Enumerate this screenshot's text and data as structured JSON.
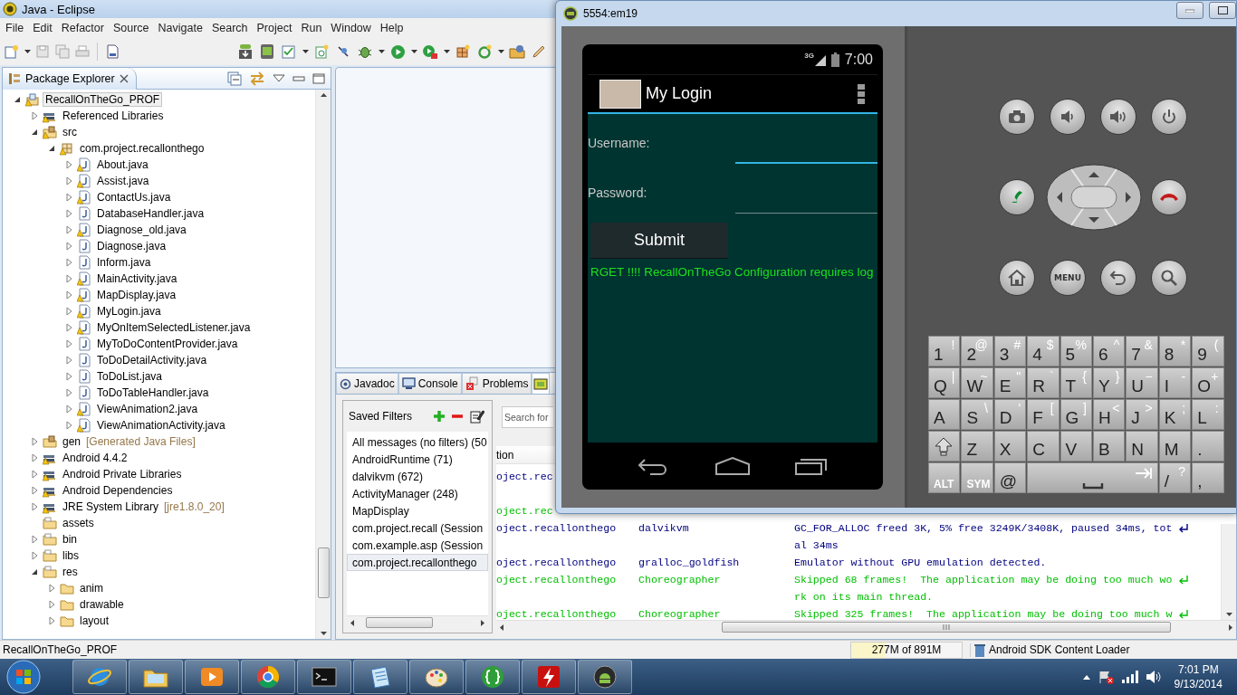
{
  "eclipse": {
    "title": "Java - Eclipse",
    "menu": [
      "File",
      "Edit",
      "Refactor",
      "Source",
      "Navigate",
      "Search",
      "Project",
      "Run",
      "Window",
      "Help"
    ],
    "package_explorer": {
      "title": "Package Explorer",
      "tree": [
        {
          "label": "RecallOnTheGo_PROF",
          "kind": "project",
          "expanded": true,
          "selected": true,
          "warning": true,
          "children": [
            {
              "label": "Referenced Libraries",
              "kind": "library",
              "expanded": false,
              "selected": false,
              "warning": true
            },
            {
              "label": "src",
              "kind": "source-folder",
              "expanded": true,
              "selected": false,
              "warning": true,
              "children": [
                {
                  "label": "com.project.recallonthego",
                  "kind": "package",
                  "expanded": true,
                  "selected": false,
                  "warning": true,
                  "children": [
                    {
                      "label": "About.java",
                      "kind": "java",
                      "expanded": false,
                      "selected": false,
                      "warning": true
                    },
                    {
                      "label": "Assist.java",
                      "kind": "java",
                      "expanded": false,
                      "selected": false,
                      "warning": true
                    },
                    {
                      "label": "ContactUs.java",
                      "kind": "java",
                      "expanded": false,
                      "selected": false,
                      "warning": true
                    },
                    {
                      "label": "DatabaseHandler.java",
                      "kind": "java",
                      "expanded": false,
                      "selected": false,
                      "warning": false
                    },
                    {
                      "label": "Diagnose_old.java",
                      "kind": "java",
                      "expanded": false,
                      "selected": false,
                      "warning": true
                    },
                    {
                      "label": "Diagnose.java",
                      "kind": "java",
                      "expanded": false,
                      "selected": false,
                      "warning": false
                    },
                    {
                      "label": "Inform.java",
                      "kind": "java",
                      "expanded": false,
                      "selected": false,
                      "warning": false
                    },
                    {
                      "label": "MainActivity.java",
                      "kind": "java",
                      "expanded": false,
                      "selected": false,
                      "warning": true
                    },
                    {
                      "label": "MapDisplay.java",
                      "kind": "java",
                      "expanded": false,
                      "selected": false,
                      "warning": true
                    },
                    {
                      "label": "MyLogin.java",
                      "kind": "java",
                      "expanded": false,
                      "selected": false,
                      "warning": true
                    },
                    {
                      "label": "MyOnItemSelectedListener.java",
                      "kind": "java",
                      "expanded": false,
                      "selected": false,
                      "warning": true
                    },
                    {
                      "label": "MyToDoContentProvider.java",
                      "kind": "java",
                      "expanded": false,
                      "selected": false,
                      "warning": false
                    },
                    {
                      "label": "ToDoDetailActivity.java",
                      "kind": "java",
                      "expanded": false,
                      "selected": false,
                      "warning": false
                    },
                    {
                      "label": "ToDoList.java",
                      "kind": "java",
                      "expanded": false,
                      "selected": false,
                      "warning": false
                    },
                    {
                      "label": "ToDoTableHandler.java",
                      "kind": "java",
                      "expanded": false,
                      "selected": false,
                      "warning": false
                    },
                    {
                      "label": "ViewAnimation2.java",
                      "kind": "java",
                      "expanded": false,
                      "selected": false,
                      "warning": true
                    },
                    {
                      "label": "ViewAnimationActivity.java",
                      "kind": "java",
                      "expanded": false,
                      "selected": false,
                      "warning": true
                    }
                  ]
                }
              ]
            },
            {
              "label": "gen",
              "decoration": "[Generated Java Files]",
              "kind": "source-folder",
              "expanded": false,
              "selected": false,
              "warning": false
            },
            {
              "label": "Android 4.4.2",
              "kind": "library",
              "expanded": false,
              "selected": false,
              "warning": true
            },
            {
              "label": "Android Private Libraries",
              "kind": "library",
              "expanded": false,
              "selected": false,
              "warning": true
            },
            {
              "label": "Android Dependencies",
              "kind": "library",
              "expanded": false,
              "selected": false,
              "warning": true
            },
            {
              "label": "JRE System Library",
              "decoration": "[jre1.8.0_20]",
              "kind": "library",
              "expanded": false,
              "selected": false,
              "warning": true
            },
            {
              "label": "assets",
              "kind": "folder-res",
              "selected": false,
              "warning": false
            },
            {
              "label": "bin",
              "kind": "folder-res",
              "expanded": false,
              "selected": false,
              "warning": false
            },
            {
              "label": "libs",
              "kind": "folder-res",
              "expanded": false,
              "selected": false,
              "warning": false
            },
            {
              "label": "res",
              "kind": "folder-res",
              "expanded": true,
              "selected": false,
              "warning": false,
              "children": [
                {
                  "label": "anim",
                  "kind": "folder",
                  "expanded": false,
                  "selected": false,
                  "warning": false
                },
                {
                  "label": "drawable",
                  "kind": "folder",
                  "expanded": false,
                  "selected": false,
                  "warning": false
                },
                {
                  "label": "layout",
                  "kind": "folder",
                  "expanded": false,
                  "selected": false,
                  "warning": false
                }
              ]
            }
          ]
        }
      ]
    },
    "bottom_view": {
      "tabs": [
        {
          "label": "Javadoc",
          "kind": "javadoc",
          "selected": false
        },
        {
          "label": "Console",
          "kind": "console",
          "selected": false
        },
        {
          "label": "Problems",
          "kind": "problems",
          "selected": false
        },
        {
          "kind": "logcat",
          "selected": true
        }
      ],
      "saved_filters": {
        "title": "Saved Filters",
        "items": [
          {
            "label": "All messages (no filters) (50",
            "selected": false
          },
          {
            "label": "AndroidRuntime (71)",
            "selected": false
          },
          {
            "label": "dalvikvm (672)",
            "selected": false
          },
          {
            "label": "ActivityManager (248)",
            "selected": false
          },
          {
            "label": "MapDisplay",
            "selected": false
          },
          {
            "label": "com.project.recall (Session",
            "selected": false
          },
          {
            "label": "com.example.asp (Session",
            "selected": false
          },
          {
            "label": "com.project.recallonthego",
            "selected": true
          }
        ]
      },
      "logcat": {
        "search": {
          "placeholder": "Search for"
        },
        "column_1_header": "tion",
        "rows": [
          {
            "column_1": "oject.rec",
            "wrapped": true,
            "kind": "debug"
          },
          {
            "column_1": "oject.rec",
            "wrapped": false,
            "kind": "info"
          },
          {
            "column_1": "oject.recallonthego",
            "column_2": "dalvikvm",
            "message": [
              "GC_FOR_ALLOC freed 3K, 5% free 3249K/3408K, paused 34ms, tot",
              "al 34ms"
            ],
            "wrapped": true,
            "kind": "debug"
          },
          {
            "column_1": "oject.recallonthego",
            "column_2": "gralloc_goldfish",
            "message": [
              "Emulator without GPU emulation detected."
            ],
            "wrapped": false,
            "kind": "debug"
          },
          {
            "column_1": "oject.recallonthego",
            "column_2": "Choreographer",
            "message": [
              "Skipped 68 frames!  The application may be doing too much wo",
              "rk on its main thread."
            ],
            "wrapped": true,
            "kind": "info"
          },
          {
            "column_1": "oject.recallonthego",
            "column_2": "Choreographer",
            "message": [
              "Skipped 325 frames!  The application may be doing too much w"
            ],
            "wrapped": true,
            "kind": "info"
          }
        ]
      }
    },
    "status_bar": {
      "text": "RecallOnTheGo_PROF",
      "memory": {
        "text": "277M of 891M",
        "level": 0.31
      },
      "job": "Android SDK Content Loader"
    }
  },
  "emulator": {
    "title": "5554:em19",
    "phone": {
      "network": "3G",
      "time": "7:00",
      "app_title": "My Login",
      "fields": [
        {
          "label": "Username:",
          "focused": true
        },
        {
          "label": "Password:",
          "focused": false
        }
      ],
      "submit": "Submit",
      "marquee": "RGET !!!! RecallOnTheGo Configuration requires log"
    },
    "hardware_buttons": [
      [
        {
          "kind": "camera"
        },
        {
          "kind": "volume-down"
        },
        {
          "kind": "volume-up"
        },
        {
          "kind": "power"
        }
      ],
      [
        {
          "kind": "call"
        },
        {
          "kind": "dpad"
        },
        {
          "kind": "end-call"
        }
      ],
      [
        {
          "kind": "home"
        },
        {
          "kind": "menu",
          "label": "MENU"
        },
        {
          "kind": "back"
        },
        {
          "kind": "search"
        }
      ]
    ],
    "keyboard": [
      [
        {
          "kind": "char",
          "main": "1",
          "alt": "!"
        },
        {
          "kind": "char",
          "main": "2",
          "alt": "@"
        },
        {
          "kind": "char",
          "main": "3",
          "alt": "#"
        },
        {
          "kind": "char",
          "main": "4",
          "alt": "$"
        },
        {
          "kind": "char",
          "main": "5",
          "alt": "%"
        },
        {
          "kind": "char",
          "main": "6",
          "alt": "^"
        },
        {
          "kind": "char",
          "main": "7",
          "alt": "&"
        },
        {
          "kind": "char",
          "main": "8",
          "alt": "*"
        },
        {
          "kind": "char",
          "main": "9",
          "alt": "("
        }
      ],
      [
        {
          "kind": "char",
          "main": "Q",
          "alt": "|"
        },
        {
          "kind": "char",
          "main": "W",
          "alt": "~"
        },
        {
          "kind": "char",
          "main": "E",
          "alt": "\""
        },
        {
          "kind": "char",
          "main": "R",
          "alt": "`"
        },
        {
          "kind": "char",
          "main": "T",
          "alt": "{"
        },
        {
          "kind": "char",
          "main": "Y",
          "alt": "}"
        },
        {
          "kind": "char",
          "main": "U",
          "alt": "−"
        },
        {
          "kind": "char",
          "main": "I",
          "alt": "-"
        },
        {
          "kind": "char",
          "main": "O",
          "alt": "+"
        }
      ],
      [
        {
          "kind": "char",
          "main": "A"
        },
        {
          "kind": "char",
          "main": "S",
          "alt": "\\"
        },
        {
          "kind": "char",
          "main": "D",
          "alt": "'"
        },
        {
          "kind": "char",
          "main": "F",
          "alt": "["
        },
        {
          "kind": "char",
          "main": "G",
          "alt": "]"
        },
        {
          "kind": "char",
          "main": "H",
          "alt": "<"
        },
        {
          "kind": "char",
          "main": "J",
          "alt": ">"
        },
        {
          "kind": "char",
          "main": "K",
          "alt": ";"
        },
        {
          "kind": "char",
          "main": "L",
          "alt": ":"
        }
      ],
      [
        {
          "kind": "shift"
        },
        {
          "kind": "char",
          "main": "Z"
        },
        {
          "kind": "char",
          "main": "X"
        },
        {
          "kind": "char",
          "main": "C"
        },
        {
          "kind": "char",
          "main": "V"
        },
        {
          "kind": "char",
          "main": "B"
        },
        {
          "kind": "char",
          "main": "N"
        },
        {
          "kind": "char",
          "main": "M"
        },
        {
          "kind": "char",
          "main": "."
        }
      ],
      [
        {
          "kind": "label",
          "main": "ALT"
        },
        {
          "kind": "label",
          "main": "SYM"
        },
        {
          "kind": "char",
          "main": "@"
        },
        {
          "kind": "space"
        },
        {
          "kind": "char",
          "main": "/",
          "alt": "?"
        },
        {
          "kind": "char",
          "main": ","
        }
      ]
    ]
  },
  "taskbar": {
    "apps": [
      {
        "kind": "globe"
      },
      {
        "kind": "folder"
      },
      {
        "kind": "media"
      },
      {
        "kind": "ring"
      },
      {
        "kind": "terminal"
      },
      {
        "kind": "notebook"
      },
      {
        "kind": "palette"
      },
      {
        "kind": "braces"
      },
      {
        "kind": "bolt"
      },
      {
        "kind": "robot"
      }
    ],
    "time": "7:01 PM",
    "date": "9/13/2014"
  }
}
